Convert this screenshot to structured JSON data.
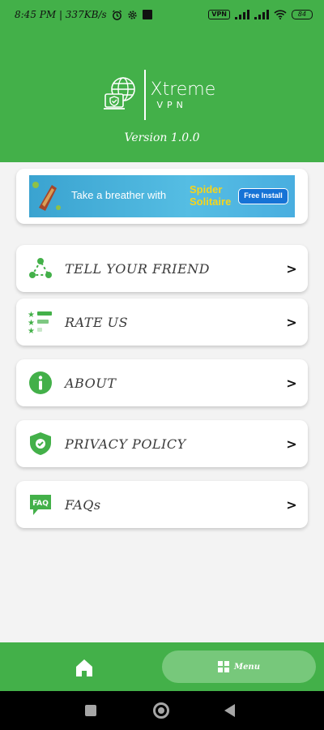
{
  "status_bar": {
    "time_speed": "8:45 PM | 337KB/s",
    "vpn_badge": "VPN",
    "battery": "84"
  },
  "header": {
    "brand": "Xtreme",
    "brand_sub": "VPN",
    "version": "Version 1.0.0"
  },
  "ad": {
    "text": "Take a breather with",
    "brand_line1": "Spider",
    "brand_line2": "Solitaire",
    "install_label": "Free Install"
  },
  "menu": {
    "items": [
      {
        "label": "TELL YOUR FRIEND",
        "icon": "share-icon"
      },
      {
        "label": "RATE US",
        "icon": "star-list-icon"
      },
      {
        "label": "ABOUT",
        "icon": "info-icon"
      },
      {
        "label": "PRIVACY POLICY",
        "icon": "shield-check-icon"
      },
      {
        "label": "FAQs",
        "icon": "faq-icon"
      }
    ],
    "chevron": ">"
  },
  "bottom_nav": {
    "menu_label": "Menu"
  },
  "colors": {
    "brand_green": "#43b049",
    "menu_active": "#77c87b"
  }
}
